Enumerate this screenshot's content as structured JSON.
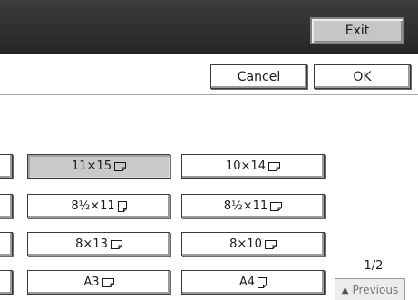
{
  "header": {
    "exit_label": "Exit"
  },
  "actions": {
    "cancel_label": "Cancel",
    "ok_label": "OK"
  },
  "sizes": [
    {
      "label": "11×15",
      "orientation": "landscape",
      "selected": true
    },
    {
      "label": "10×14",
      "orientation": "landscape",
      "selected": false
    },
    {
      "label": "8½×11",
      "orientation": "portrait",
      "selected": false
    },
    {
      "label": "8½×11",
      "orientation": "landscape",
      "selected": false
    },
    {
      "label": "8×13",
      "orientation": "landscape",
      "selected": false
    },
    {
      "label": "8×10",
      "orientation": "landscape",
      "selected": false
    },
    {
      "label": "A3",
      "orientation": "landscape",
      "selected": false
    },
    {
      "label": "A4",
      "orientation": "portrait",
      "selected": false
    }
  ],
  "pagination": {
    "indicator": "1/2",
    "previous_label": "Previous",
    "previous_icon": "triangle-up-icon"
  }
}
